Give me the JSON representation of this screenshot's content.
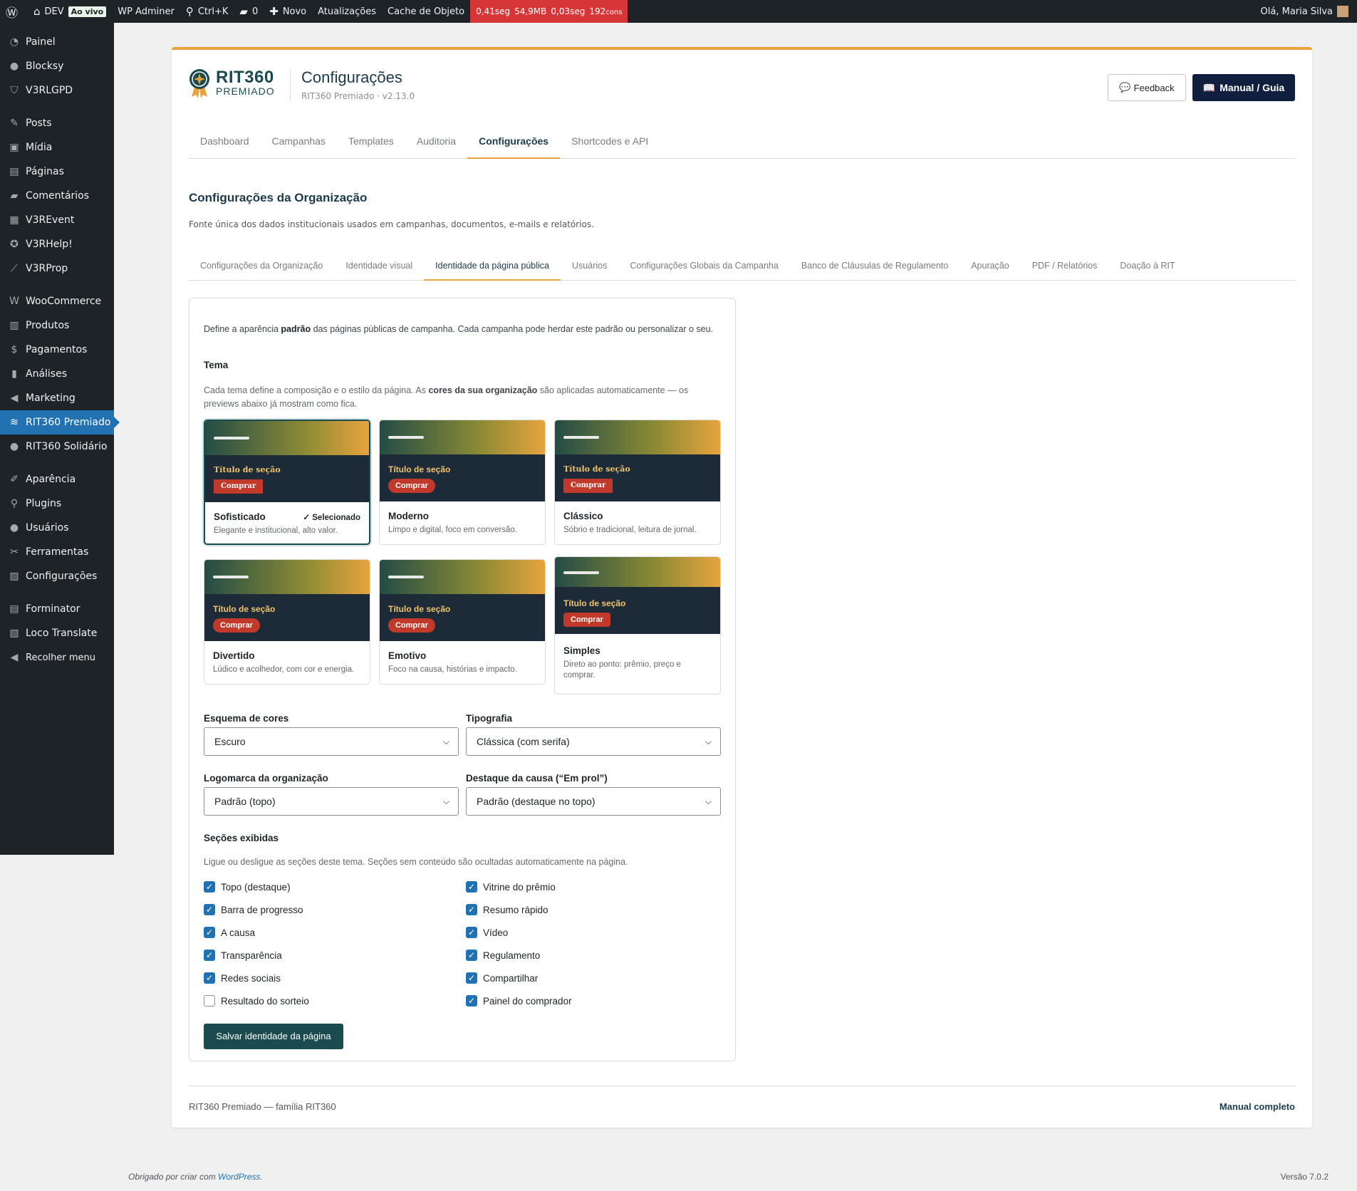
{
  "adminbar": {
    "site": "DEV",
    "live": "Ao vivo",
    "adminer": "WP Adminer",
    "search": "Ctrl+K",
    "comments": "0",
    "new": "Novo",
    "updates": "Atualizações",
    "cache": "Cache de Objeto",
    "perf_time": "0,41seg",
    "perf_mem": "54,9MB",
    "perf_db": "0,03seg",
    "perf_q": "192",
    "perf_q_unit": "cons",
    "greeting": "Olá, Maria Silva"
  },
  "sidebar": {
    "items": [
      {
        "label": "Painel",
        "icon": "dashboard-icon",
        "glyph": "◔"
      },
      {
        "label": "Blocksy",
        "icon": "blocksy-icon",
        "glyph": "●"
      },
      {
        "label": "V3RLGPD",
        "icon": "shield-icon",
        "glyph": "⛉"
      },
      {
        "label": "Posts",
        "icon": "pin-icon",
        "glyph": "✎"
      },
      {
        "label": "Mídia",
        "icon": "media-icon",
        "glyph": "▣"
      },
      {
        "label": "Páginas",
        "icon": "pages-icon",
        "glyph": "▤"
      },
      {
        "label": "Comentários",
        "icon": "comments-icon",
        "glyph": "▰"
      },
      {
        "label": "V3REvent",
        "icon": "calendar-icon",
        "glyph": "▦"
      },
      {
        "label": "V3RHelp!",
        "icon": "help-icon",
        "glyph": "✪"
      },
      {
        "label": "V3RProp",
        "icon": "chart-icon",
        "glyph": "⟋"
      },
      {
        "label": "WooCommerce",
        "icon": "woo-icon",
        "glyph": "W"
      },
      {
        "label": "Produtos",
        "icon": "box-icon",
        "glyph": "▥"
      },
      {
        "label": "Pagamentos",
        "icon": "dollar-icon",
        "glyph": "$"
      },
      {
        "label": "Análises",
        "icon": "bars-icon",
        "glyph": "▮"
      },
      {
        "label": "Marketing",
        "icon": "megaphone-icon",
        "glyph": "◀"
      },
      {
        "label": "RIT360 Premiado",
        "icon": "ticket-icon",
        "glyph": "≋"
      },
      {
        "label": "RIT360 Solidário",
        "icon": "circle-icon",
        "glyph": "●"
      },
      {
        "label": "Aparência",
        "icon": "brush-icon",
        "glyph": "✐"
      },
      {
        "label": "Plugins",
        "icon": "plug-icon",
        "glyph": "⚲"
      },
      {
        "label": "Usuários",
        "icon": "user-icon",
        "glyph": "●"
      },
      {
        "label": "Ferramentas",
        "icon": "wrench-icon",
        "glyph": "✂"
      },
      {
        "label": "Configurações",
        "icon": "settings-icon",
        "glyph": "▨"
      },
      {
        "label": "Forminator",
        "icon": "form-icon",
        "glyph": "▤"
      },
      {
        "label": "Loco Translate",
        "icon": "translate-icon",
        "glyph": "▧"
      },
      {
        "label": "Recolher menu",
        "icon": "collapse-icon",
        "glyph": "◀"
      }
    ]
  },
  "header": {
    "brand_name": "RIT360",
    "brand_sub": "PREMIADO",
    "title": "Configurações",
    "subtitle": "RIT360 Premiado · v2.13.0",
    "feedback": "Feedback",
    "manual": "Manual / Guia"
  },
  "main_tabs": [
    "Dashboard",
    "Campanhas",
    "Templates",
    "Auditoria",
    "Configurações",
    "Shortcodes e API"
  ],
  "section": {
    "title": "Configurações da Organização",
    "desc": "Fonte única dos dados institucionais usados em campanhas, documentos, e-mails e relatórios."
  },
  "sub_tabs": [
    "Configurações da Organização",
    "Identidade visual",
    "Identidade da página pública",
    "Usuários",
    "Configurações Globais da Campanha",
    "Banco de Cláusulas de Regulamento",
    "Apuração",
    "PDF / Relatórios",
    "Doação à RIT"
  ],
  "panel": {
    "intro_a": "Define a aparência ",
    "intro_b": "padrão",
    "intro_c": " das páginas públicas de campanha. Cada campanha pode herdar este padrão ou personalizar o seu.",
    "tema_label": "Tema",
    "tema_hint_a": "Cada tema define a composição e o estilo da página. As ",
    "tema_hint_b": "cores da sua organização",
    "tema_hint_c": " são aplicadas automaticamente — os previews abaixo já mostram como fica.",
    "preview_heading": "Título de seção",
    "preview_button": "Comprar",
    "selected_tag": "✓ Selecionado",
    "themes": [
      {
        "name": "Sofisticado",
        "desc": "Elegante e institucional, alto valor."
      },
      {
        "name": "Moderno",
        "desc": "Limpo e digital, foco em conversão."
      },
      {
        "name": "Clássico",
        "desc": "Sóbrio e tradicional, leitura de jornal."
      },
      {
        "name": "Divertido",
        "desc": "Lúdico e acolhedor, com cor e energia."
      },
      {
        "name": "Emotivo",
        "desc": "Foco na causa, histórias e impacto."
      },
      {
        "name": "Simples",
        "desc": "Direto ao ponto: prêmio, preço e comprar."
      }
    ],
    "esquema_label": "Esquema de cores",
    "esquema_value": "Escuro",
    "tipografia_label": "Tipografia",
    "tipografia_value": "Clássica (com serifa)",
    "logo_label": "Logomarca da organização",
    "logo_value": "Padrão (topo)",
    "destaque_label": "Destaque da causa (“Em prol”)",
    "destaque_value": "Padrão (destaque no topo)",
    "secoes_label": "Seções exibidas",
    "secoes_hint": "Ligue ou desligue as seções deste tema. Seções sem conteúdo são ocultadas automaticamente na página.",
    "checkboxes_left": [
      {
        "label": "Topo (destaque)",
        "checked": true
      },
      {
        "label": "Barra de progresso",
        "checked": true
      },
      {
        "label": "A causa",
        "checked": true
      },
      {
        "label": "Transparência",
        "checked": true
      },
      {
        "label": "Redes sociais",
        "checked": true
      },
      {
        "label": "Resultado do sorteio",
        "checked": false
      }
    ],
    "checkboxes_right": [
      {
        "label": "Vitrine do prêmio",
        "checked": true
      },
      {
        "label": "Resumo rápido",
        "checked": true
      },
      {
        "label": "Vídeo",
        "checked": true
      },
      {
        "label": "Regulamento",
        "checked": true
      },
      {
        "label": "Compartilhar",
        "checked": true
      },
      {
        "label": "Painel do comprador",
        "checked": true
      }
    ],
    "save": "Salvar identidade da página"
  },
  "footer": {
    "left": "RIT360 Premiado — família RIT360",
    "right": "Manual completo"
  },
  "wp_footer": {
    "thanks": "Obrigado por criar com ",
    "link": "WordPress",
    "dot": ".",
    "version": "Versão 7.0.2"
  },
  "colors": {
    "accent": "#e8a33d",
    "brand": "#1b4a4f",
    "navy": "#0f1f3d",
    "wp_blue": "#2271b1"
  }
}
